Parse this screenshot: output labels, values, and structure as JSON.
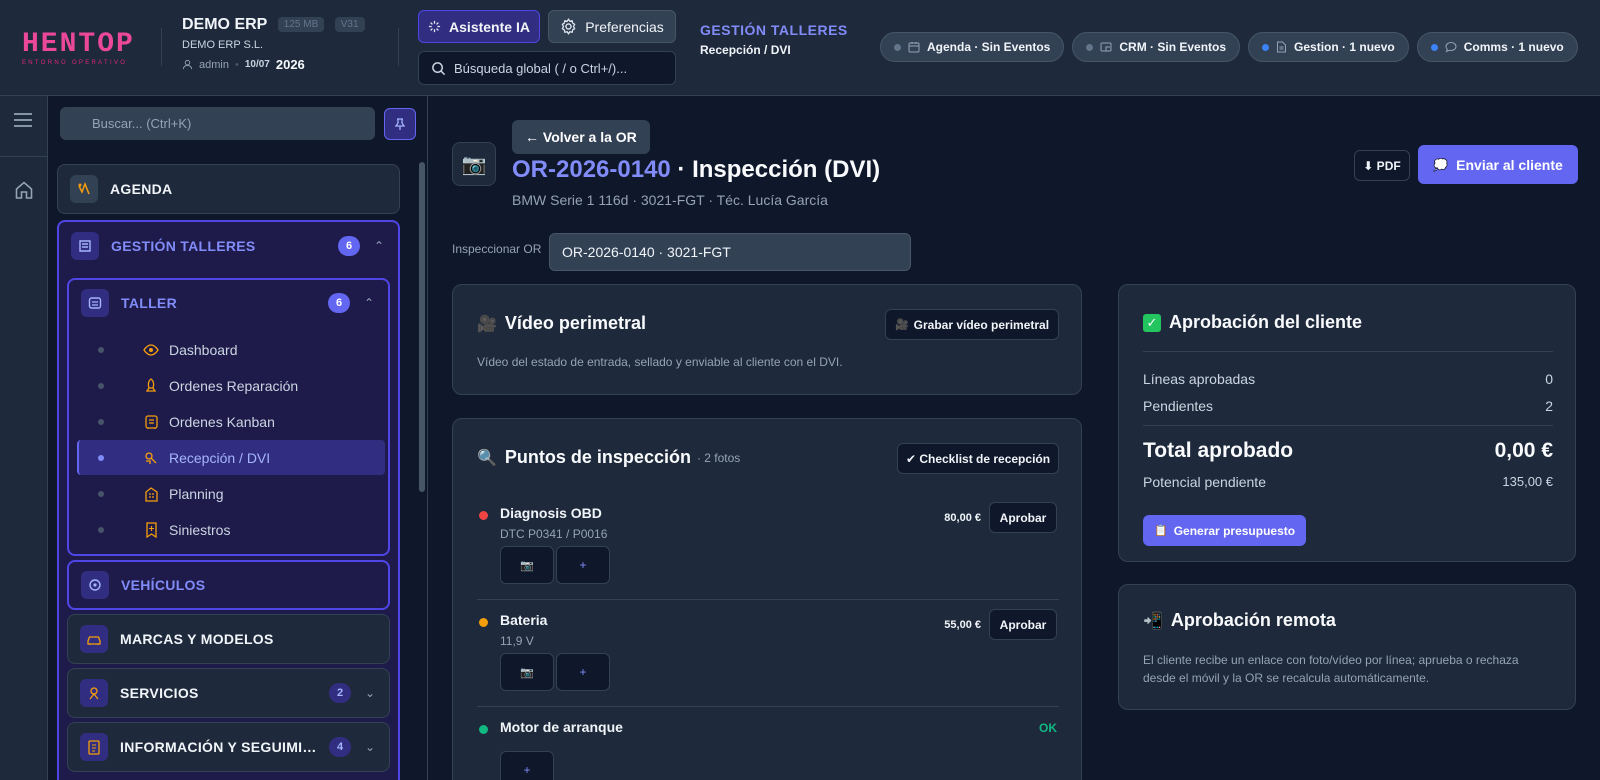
{
  "brand": {
    "logo_text": "HENTOP",
    "logo_tagline": "ENTORNO OPERATIVO",
    "app_name": "DEMO ERP",
    "mem_badge": "125 MB",
    "version_badge": "V31",
    "company": "DEMO ERP S.L.",
    "user": "admin",
    "date": "10/07",
    "year": "2026"
  },
  "header": {
    "ai_button": "Asistente IA",
    "prefs_button": "Preferencias",
    "search_placeholder": "Búsqueda global ( / o Ctrl+/)...",
    "section": "GESTIÓN TALLERES",
    "subsection": "Recepción / DVI",
    "pills": [
      {
        "label": "Agenda · Sin Eventos",
        "icon": "calendar-icon",
        "dot": "#64748b"
      },
      {
        "label": "CRM · Sin Eventos",
        "icon": "crm-icon",
        "dot": "#64748b"
      },
      {
        "label": "Gestion · 1 nuevo",
        "icon": "document-icon",
        "dot": "#3b82f6"
      },
      {
        "label": "Comms · 1 nuevo",
        "icon": "chat-icon",
        "dot": "#3b82f6"
      }
    ]
  },
  "sidebar": {
    "search_placeholder": "Buscar... (Ctrl+K)",
    "agenda": "AGENDA",
    "gestion": {
      "label": "GESTIÓN TALLERES",
      "count": "6"
    },
    "taller": {
      "label": "TALLER",
      "count": "6"
    },
    "taller_items": [
      "Dashboard",
      "Ordenes Reparación",
      "Ordenes Kanban",
      "Recepción / DVI",
      "Planning",
      "Siniestros"
    ],
    "vehiculos": "VEHÍCULOS",
    "marcas": "MARCAS Y MODELOS",
    "servicios": {
      "label": "SERVICIOS",
      "count": "2"
    },
    "informacion": {
      "label": "INFORMACIÓN Y SEGUIMIEN...",
      "count": "4"
    }
  },
  "main": {
    "back_button": "← Volver a la OR",
    "order_code": "OR-2026-0140",
    "title_suffix": " · Inspección (DVI)",
    "subtitle": "BMW Serie 1 116d · 3021-FGT · Téc. Lucía García",
    "pdf_button": "⬇ PDF",
    "send_button": "Enviar al cliente",
    "inspect_label": "Inspeccionar OR",
    "inspect_value": "OR-2026-0140 · 3021-FGT",
    "video": {
      "title": "Vídeo perimetral",
      "record_button": "Grabar vídeo perimetral",
      "desc": "Vídeo del estado de entrada, sellado y enviable al cliente con el DVI."
    },
    "inspection": {
      "title": "Puntos de inspección",
      "photos": "· 2 fotos",
      "checklist_button": "✔ Checklist de recepción",
      "add_symbol": "+",
      "items": [
        {
          "name": "Diagnosis OBD",
          "note": "DTC P0341 / P0016",
          "price": "80,00 €",
          "action": "Aprobar",
          "status_color": "#ef4444"
        },
        {
          "name": "Bateria",
          "note": "11,9 V",
          "price": "55,00 €",
          "action": "Aprobar",
          "status_color": "#f59e0b"
        },
        {
          "name": "Motor de arranque",
          "note": "",
          "status": "OK",
          "status_color": "#10b981"
        }
      ]
    },
    "approval": {
      "title": "Aprobación del cliente",
      "approved_label": "Líneas aprobadas",
      "approved_value": "0",
      "pending_label": "Pendientes",
      "pending_value": "2",
      "total_label": "Total aprobado",
      "total_value": "0,00 €",
      "potential_label": "Potencial pendiente",
      "potential_value": "135,00 €",
      "generate_button": "Generar presupuesto"
    },
    "remote": {
      "title": "Aprobación remota",
      "desc": "El cliente recibe un enlace con foto/vídeo por línea; aprueba o rechaza desde el móvil y la OR se recalcula automáticamente."
    }
  },
  "colors": {
    "accent": "#6366f1",
    "accent_text": "#818cf8",
    "ok": "#10b981",
    "danger": "#ef4444",
    "warning": "#f59e0b",
    "logo": "#ec4899"
  }
}
